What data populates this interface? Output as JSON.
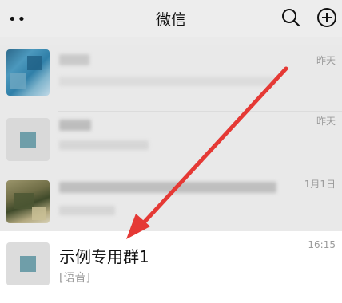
{
  "header": {
    "menu_icon": "more-dots-icon",
    "menu_glyph": "••",
    "title": "微信",
    "search_icon": "search-icon",
    "add_icon": "plus-circle-icon"
  },
  "chats": [
    {
      "time": "昨天"
    },
    {
      "time": "昨天"
    },
    {
      "time": "1月1日"
    },
    {
      "name": "示例专用群1",
      "preview": "[语音]",
      "time": "16:15"
    }
  ],
  "colors": {
    "background": "#ededed",
    "highlighted_row": "#ffffff",
    "arrow": "#e53935"
  }
}
